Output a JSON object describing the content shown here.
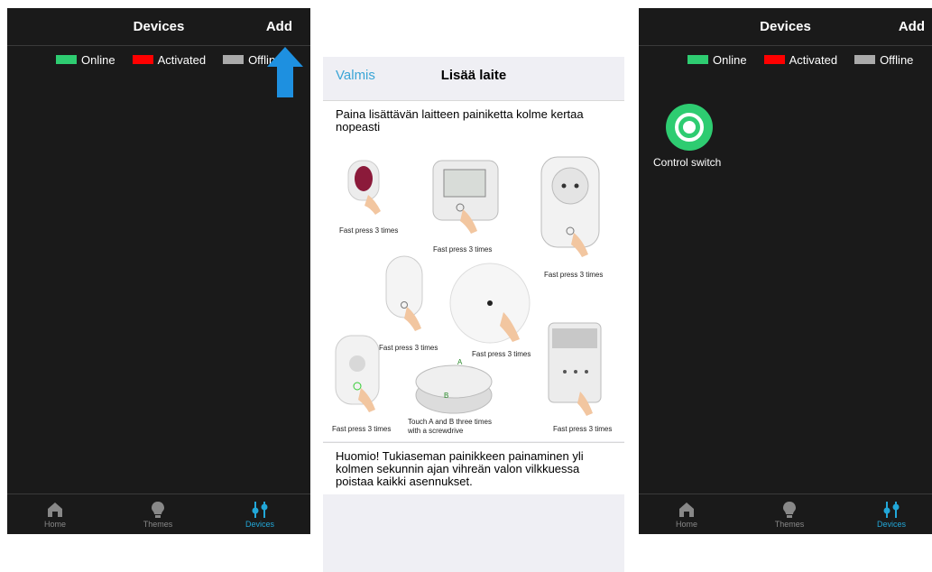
{
  "left_phone": {
    "header": {
      "title": "Devices",
      "add_label": "Add"
    },
    "legend": [
      {
        "label": "Online",
        "color": "#2ecc71"
      },
      {
        "label": "Activated",
        "color": "#ff0000"
      },
      {
        "label": "Offline",
        "color": "#aaaaaa"
      }
    ],
    "tabs": [
      {
        "label": "Home",
        "icon": "home-icon"
      },
      {
        "label": "Themes",
        "icon": "bulb-icon"
      },
      {
        "label": "Devices",
        "icon": "devices-icon",
        "active": true
      }
    ],
    "arrow_color": "#1e90e0"
  },
  "middle_panel": {
    "nav": {
      "done_label": "Valmis",
      "title": "Lisää laite"
    },
    "instruction": "Paina lisättävän laitteen painiketta kolme kertaa nopeasti",
    "image_captions": {
      "c1": "Fast press 3 times",
      "c2": "Fast press 3 times",
      "c3": "Fast press 3 times",
      "c4": "Fast press 3 times",
      "c5": "Fast press 3 times",
      "c6": "Fast press 3 times",
      "c7": "Fast press 3 times",
      "c8a": "Touch A and B three times",
      "c8b": "with a screwdrive",
      "label_a": "A",
      "label_b": "B"
    },
    "note": "Huomio! Tukiaseman painikkeen painaminen yli kolmen sekunnin ajan vihreän valon vilkkuessa poistaa kaikki asennukset."
  },
  "right_phone": {
    "header": {
      "title": "Devices",
      "add_label": "Add"
    },
    "legend": [
      {
        "label": "Online",
        "color": "#2ecc71"
      },
      {
        "label": "Activated",
        "color": "#ff0000"
      },
      {
        "label": "Offline",
        "color": "#aaaaaa"
      }
    ],
    "device": {
      "label": "Control switch",
      "color": "#2ecc71"
    },
    "tabs": [
      {
        "label": "Home",
        "icon": "home-icon"
      },
      {
        "label": "Themes",
        "icon": "bulb-icon"
      },
      {
        "label": "Devices",
        "icon": "devices-icon",
        "active": true
      }
    ]
  }
}
